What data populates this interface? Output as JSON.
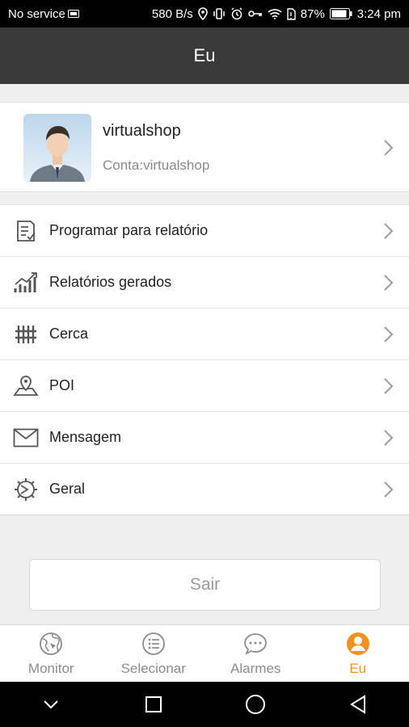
{
  "status_bar": {
    "carrier": "No service",
    "speed": "580 B/s",
    "battery": "87%",
    "time": "3:24 pm"
  },
  "header": {
    "title": "Eu"
  },
  "profile": {
    "name": "virtualshop",
    "account": "Conta:virtualshop"
  },
  "menu": {
    "items": [
      {
        "label": "Programar para relatório",
        "icon": "report-schedule-icon"
      },
      {
        "label": "Relatórios gerados",
        "icon": "chart-trend-icon"
      },
      {
        "label": "Cerca",
        "icon": "fence-icon"
      },
      {
        "label": "POI",
        "icon": "map-pin-icon"
      },
      {
        "label": "Mensagem",
        "icon": "envelope-icon"
      },
      {
        "label": "Geral",
        "icon": "gear-icon"
      }
    ]
  },
  "logout": {
    "label": "Sair"
  },
  "tabbar": {
    "tabs": [
      {
        "label": "Monitor",
        "icon": "globe-icon",
        "active": false
      },
      {
        "label": "Selecionar",
        "icon": "list-icon",
        "active": false
      },
      {
        "label": "Alarmes",
        "icon": "chat-bubble-icon",
        "active": false
      },
      {
        "label": "Eu",
        "icon": "person-icon",
        "active": true
      }
    ],
    "active_color": "#f0921b",
    "inactive_color": "#8c8c8c"
  },
  "colors": {
    "header_bg": "#3a3a3a",
    "page_bg": "#efefef"
  }
}
